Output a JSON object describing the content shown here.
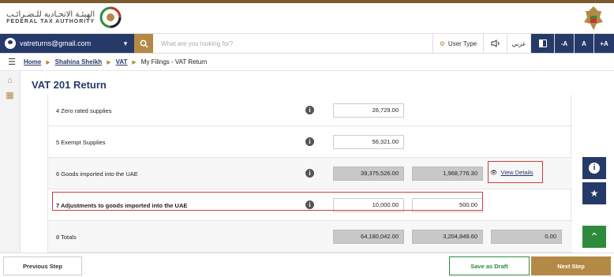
{
  "header": {
    "logo_ar": "الهيئـة الاتحـادية للـضـرائـب",
    "logo_en": "FEDERAL TAX AUTHORITY"
  },
  "toolbar": {
    "user_email": "vatreturns@gmail.com",
    "search_placeholder": "What are you looking for?",
    "user_type": "User Type",
    "lang": "عربي",
    "font_minus": "-A",
    "font_normal": "A",
    "font_plus": "+A"
  },
  "breadcrumb": {
    "home": "Home",
    "user": "Shahina Sheikh",
    "vat": "VAT",
    "current": "My Filings - VAT Return"
  },
  "page_title": "VAT 201 Return",
  "rows": [
    {
      "label": "4 Zero rated supplies",
      "amount": "26,729.00"
    },
    {
      "label": "5 Exempt Supplies",
      "amount": "56,321.00"
    },
    {
      "label": "6 Goods imported into the UAE",
      "amount": "39,375,526.00",
      "vat": "1,968,776.30",
      "link": "View Details"
    },
    {
      "label": "7 Adjustments to goods imported into the UAE",
      "amount": "10,000.00",
      "vat": "500.00"
    },
    {
      "label": "8 Totals",
      "amount": "64,180,042.00",
      "vat": "3,204,849.60",
      "adj": "0.00"
    }
  ],
  "footer": {
    "prev": "Previous Step",
    "draft": "Save as Draft",
    "next": "Next Step"
  },
  "colors": {
    "navy": "#263a6a",
    "gold": "#b38a45",
    "highlight": "#d23b3b",
    "fab_green": "#2e8b3d"
  }
}
